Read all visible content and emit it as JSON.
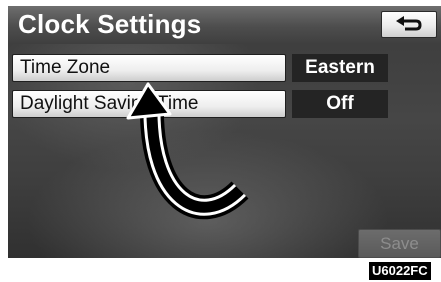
{
  "header": {
    "title": "Clock Settings",
    "back_icon": "return-arrow-icon"
  },
  "settings": [
    {
      "label": "Time Zone",
      "value": "Eastern"
    },
    {
      "label": "Daylight Saving Time",
      "value": "Off"
    }
  ],
  "footer": {
    "save_label": "Save",
    "save_enabled": false
  },
  "figure_code": "U6022FC",
  "colors": {
    "screen_background": "#444444",
    "value_box": "#242424",
    "button_face": "#eeeeee",
    "disabled_text": "#8d8d8d"
  },
  "annotation": {
    "icon": "curved-pointer-arrow-icon",
    "points_to": "Time Zone"
  }
}
